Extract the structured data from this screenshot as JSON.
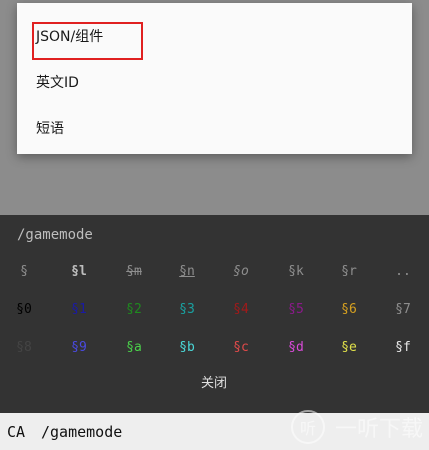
{
  "menu": {
    "items": [
      {
        "label": "JSON/组件",
        "highlighted": true
      },
      {
        "label": "英文ID",
        "highlighted": false
      },
      {
        "label": "短语",
        "highlighted": false
      }
    ],
    "highlight_color": "#e02020"
  },
  "panel": {
    "command": "/gamemode",
    "rows": [
      [
        {
          "text": "§",
          "color": "#8e8e8e"
        },
        {
          "text": "§l",
          "color": "#bdbdbd",
          "style": "bold"
        },
        {
          "text": "§m",
          "color": "#8e8e8e",
          "style": "strike"
        },
        {
          "text": "§n",
          "color": "#8e8e8e",
          "style": "underline"
        },
        {
          "text": "§o",
          "color": "#8e8e8e",
          "style": "italic"
        },
        {
          "text": "§k",
          "color": "#8e8e8e"
        },
        {
          "text": "§r",
          "color": "#8e8e8e"
        },
        {
          "text": "..",
          "color": "#8e8e8e"
        }
      ],
      [
        {
          "text": "§0",
          "color": "#000000"
        },
        {
          "text": "§1",
          "color": "#1a1aa6"
        },
        {
          "text": "§2",
          "color": "#1f8a1f"
        },
        {
          "text": "§3",
          "color": "#1aa0a0"
        },
        {
          "text": "§4",
          "color": "#a01a1a"
        },
        {
          "text": "§5",
          "color": "#8a1a8a"
        },
        {
          "text": "§6",
          "color": "#d6a020"
        },
        {
          "text": "§7",
          "color": "#8e8e8e"
        }
      ],
      [
        {
          "text": "§8",
          "color": "#444444"
        },
        {
          "text": "§9",
          "color": "#4a4ae0"
        },
        {
          "text": "§a",
          "color": "#4ad04a"
        },
        {
          "text": "§b",
          "color": "#4ad8d8"
        },
        {
          "text": "§c",
          "color": "#e04a4a"
        },
        {
          "text": "§d",
          "color": "#d84ad8"
        },
        {
          "text": "§e",
          "color": "#e0e04a"
        },
        {
          "text": "§f",
          "color": "#e8e8e8"
        }
      ]
    ],
    "close_label": "关闭"
  },
  "input": {
    "prefix": "CA",
    "value": "/gamemode"
  },
  "watermark": {
    "logo": "听",
    "text": "一听下载"
  }
}
